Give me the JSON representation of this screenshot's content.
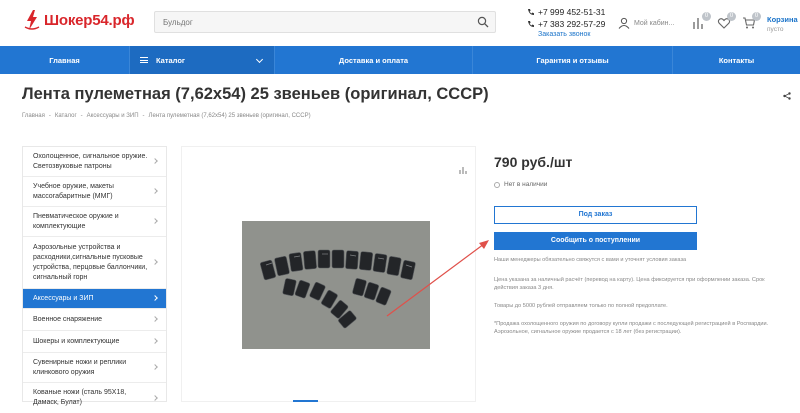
{
  "header": {
    "logo_text": "Шокер54.рф",
    "search_placeholder": "Бульдог",
    "phone1": "+7 999 452-51-31",
    "phone2": "+7 383 292-57-29",
    "callback": "Заказать звонок",
    "cabinet": "Мой кабин...",
    "compare_count": "0",
    "favorites_count": "0",
    "cart_count": "0",
    "cart_label": "Корзина",
    "cart_sub": "пусто"
  },
  "nav": {
    "home": "Главная",
    "catalog": "Каталог",
    "delivery": "Доставка и оплата",
    "warranty": "Гарантия и отзывы",
    "contacts": "Контакты"
  },
  "page": {
    "title": "Лента пулеметная (7,62х54) 25 звеньев (оригинал, СССР)",
    "breadcrumb": [
      "Главная",
      "-",
      "Каталог",
      "-",
      "Аксессуары и ЗИП",
      "-",
      "Лента пулеметная (7,62х54) 25 звеньев (оригинал, СССР)"
    ]
  },
  "sidebar": {
    "items": [
      {
        "label": "Охолощенное, сигнальное оружие. Светозвуковые патроны"
      },
      {
        "label": "Учебное оружие, макеты массогабаритные (ММГ)"
      },
      {
        "label": "Пневматическое оружие и комплектующие"
      },
      {
        "label": "Аэрозольные устройства и расходники,сигнальные пусковые устройства, перцовые баллончики, сигнальный горн"
      },
      {
        "label": "Аксессуары и ЗИП"
      },
      {
        "label": "Военное снаряжение"
      },
      {
        "label": "Шокеры и комплектующие"
      },
      {
        "label": "Сувенирные ножи и реплики клинкового оружия"
      },
      {
        "label": "Кованые ножи (сталь 95Х18, Дамаск, Булат)"
      }
    ]
  },
  "product": {
    "price": "790 руб./шт",
    "stock": "Нет в наличии",
    "order_btn": "Под заказ",
    "notify_btn": "Сообщить о поступлении",
    "note1": "Наши менеджеры обязательно свяжутся с вами и уточнят условия заказа",
    "note2": "Цена указана за наличный расчёт (перевод на карту). Цена фиксируется при оформлении заказа. Срок действия заказа 3 дня.",
    "note3": "Товары до 5000 рублей отправляем только по полной предоплате.",
    "note4": "*Продажа охолощенного оружия по договору купли продажи с последующей регистрацией в Росгвардии. Аэрозольное, сигнальное оружие продается с 18 лет (без регистрации)."
  },
  "colors": {
    "brand_red": "#d9262b",
    "accent_blue": "#2276d2",
    "annotation_arrow": "#e0504a"
  }
}
